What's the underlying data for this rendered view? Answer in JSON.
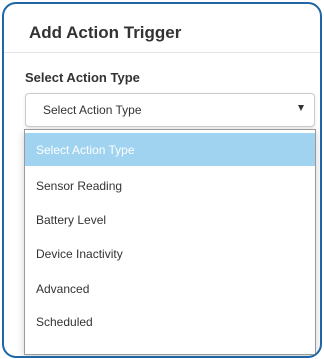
{
  "modal": {
    "title": "Add Action Trigger",
    "field_label": "Select Action Type"
  },
  "select": {
    "value": "Select Action Type",
    "caret_icon": "caret-down-icon"
  },
  "dropdown": {
    "options": [
      {
        "label": "Select Action Type",
        "selected": true
      },
      {
        "label": "Sensor Reading",
        "selected": false
      },
      {
        "label": "Battery Level",
        "selected": false
      },
      {
        "label": "Device Inactivity",
        "selected": false
      },
      {
        "label": "Advanced",
        "selected": false
      },
      {
        "label": "Scheduled",
        "selected": false
      }
    ]
  },
  "colors": {
    "frame_border": "#1e66a6",
    "selected_option_bg": "#9fd3f0",
    "text": "#333333"
  }
}
